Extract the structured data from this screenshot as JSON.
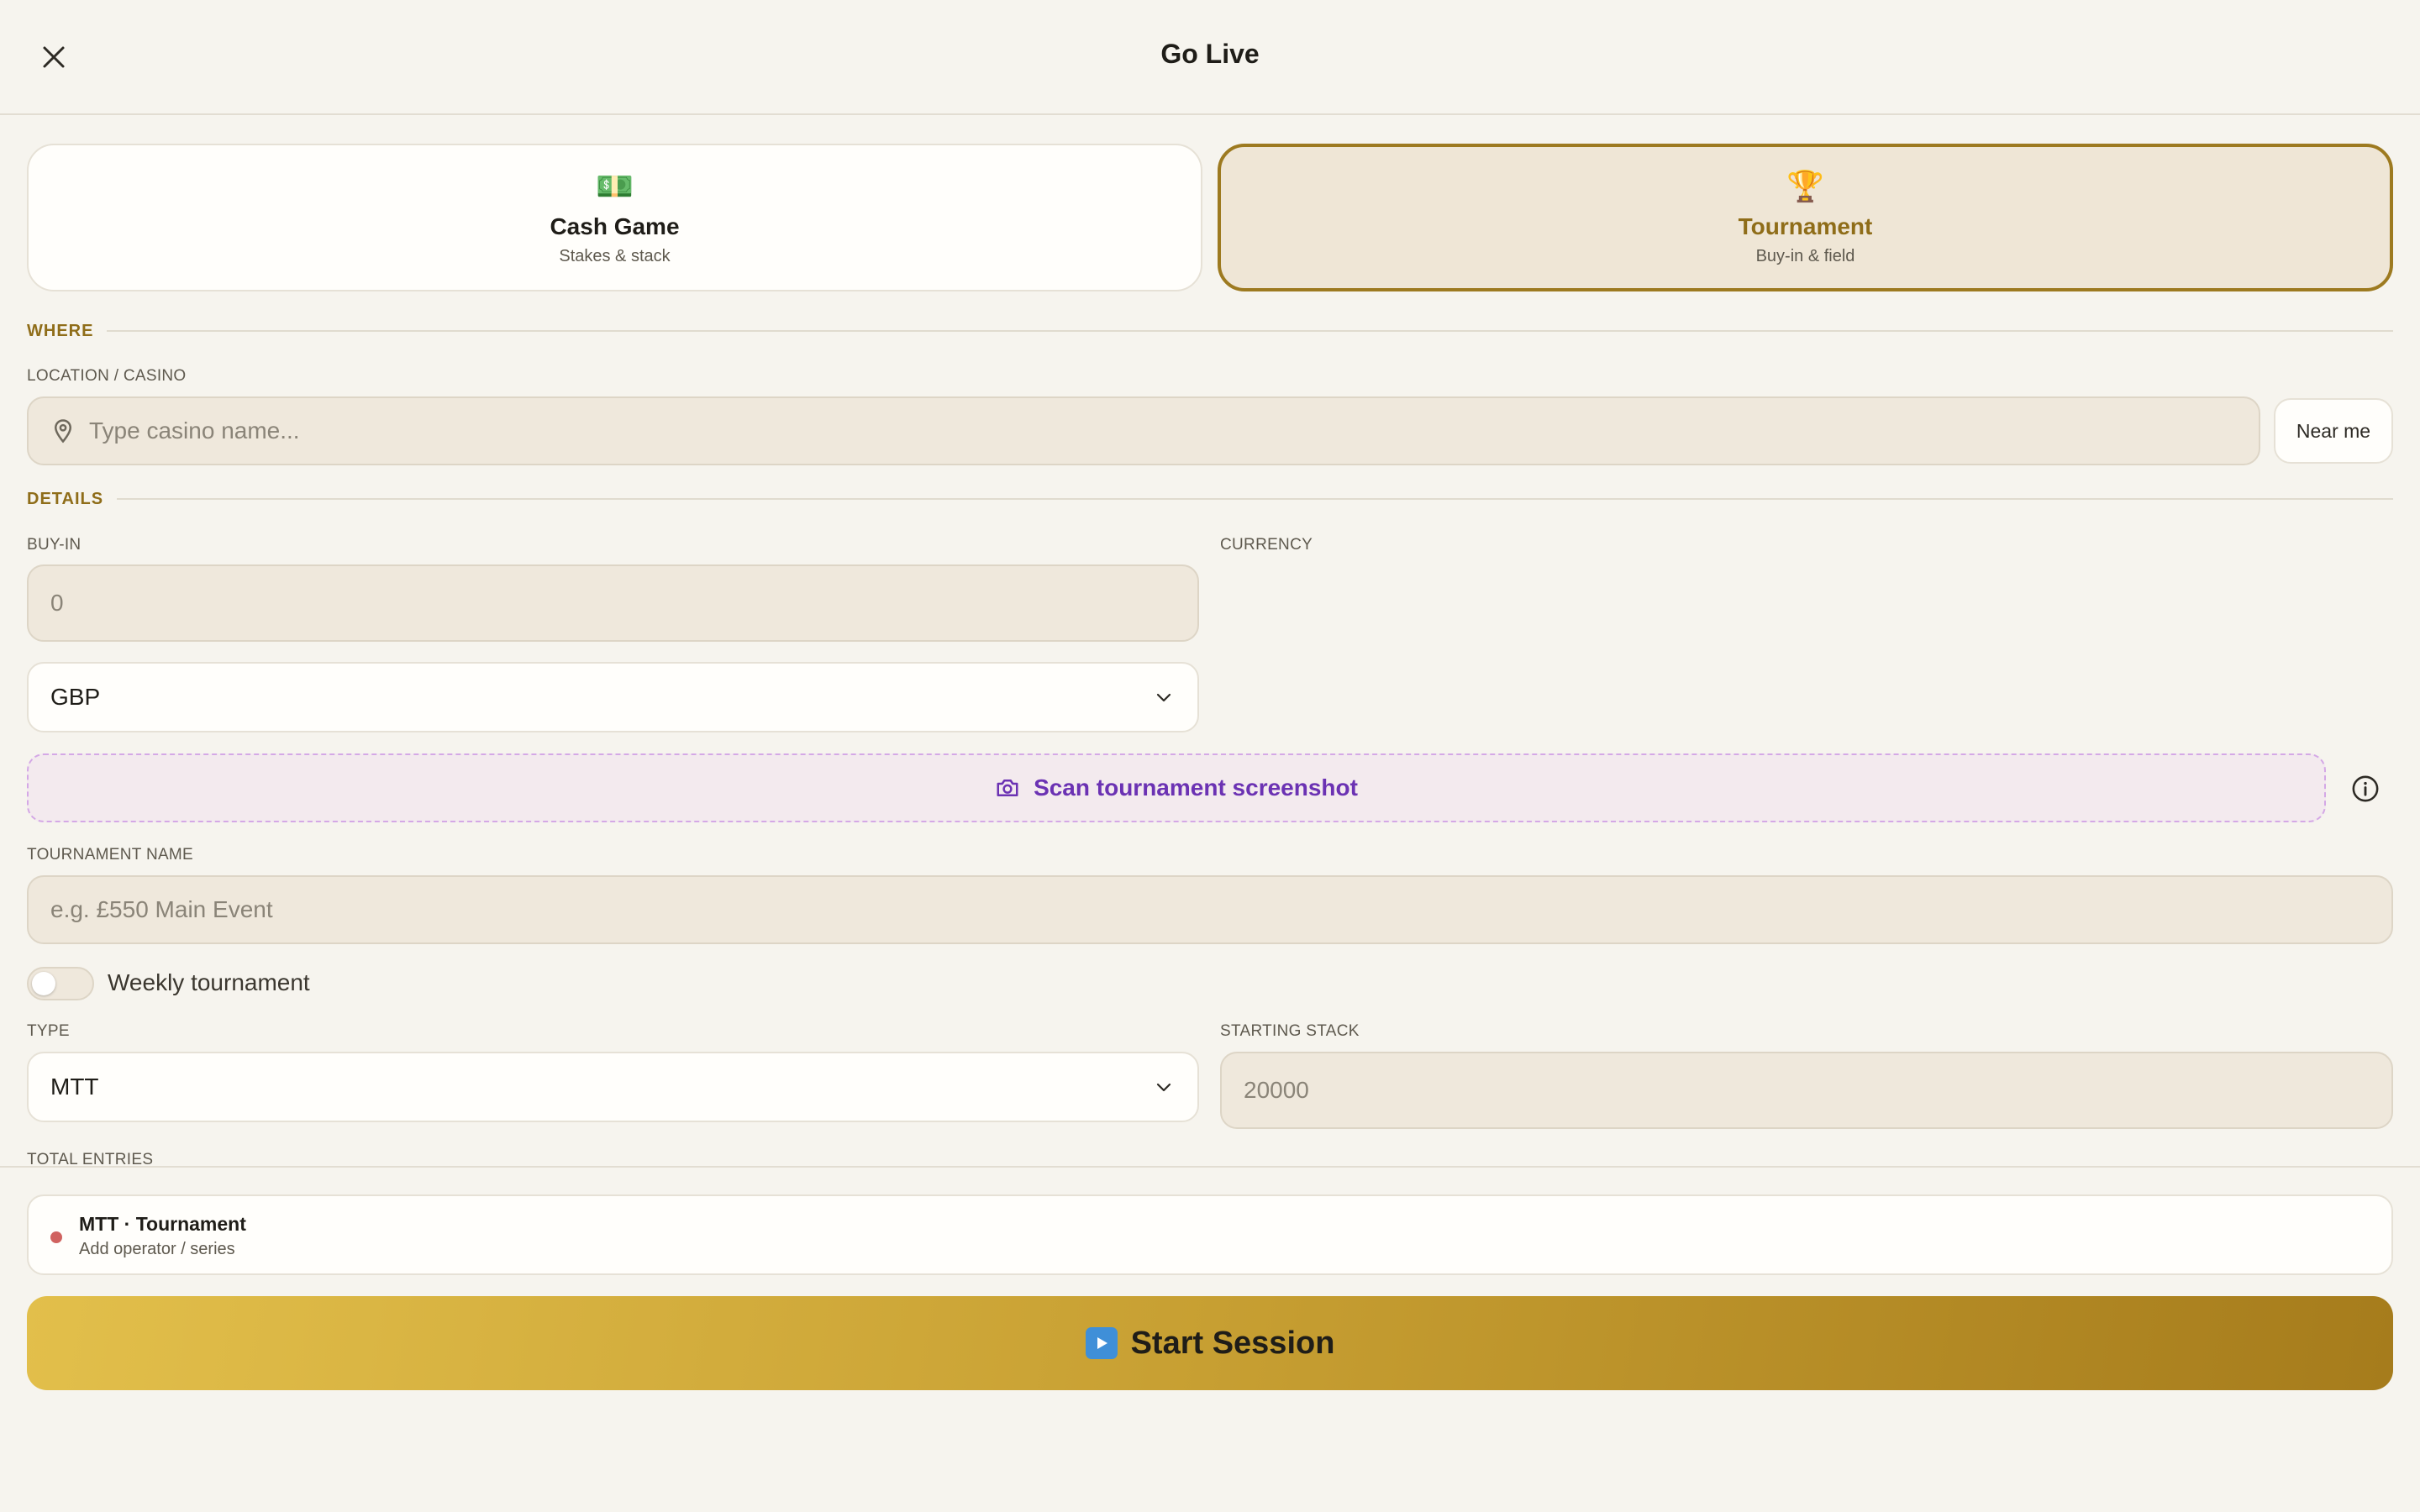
{
  "header": {
    "title": "Go Live",
    "close_icon": "close-icon"
  },
  "modes": {
    "cash": {
      "emoji": "💵",
      "label": "Cash Game",
      "sub": "Stakes & stack"
    },
    "tournament": {
      "emoji": "🏆",
      "label": "Tournament",
      "sub": "Buy-in & field",
      "selected": true
    }
  },
  "where": {
    "section": "WHERE",
    "location_label": "LOCATION / CASINO",
    "location_placeholder": "Type casino name...",
    "near_me": "Near me"
  },
  "details": {
    "section": "DETAILS",
    "buyin_label": "BUY-IN",
    "buyin_value": "0",
    "currency_label": "CURRENCY",
    "currency_value": "GBP",
    "scan_label": "Scan tournament screenshot",
    "tournament_name_label": "TOURNAMENT NAME",
    "tournament_name_placeholder": "e.g. £550 Main Event",
    "weekly_label": "Weekly tournament",
    "weekly_on": false,
    "type_label": "TYPE",
    "type_value": "MTT",
    "stack_label": "STARTING STACK",
    "stack_value": "20000",
    "total_entries_label": "TOTAL ENTRIES"
  },
  "summary": {
    "title": "MTT · Tournament",
    "sub": "Add operator / series",
    "dot_color": "#d0625f"
  },
  "start": {
    "label": "Start Session",
    "icon": "play-icon"
  },
  "colors": {
    "accent": "#8f6d19",
    "scan_accent": "#6b32b3",
    "background": "#f6f4ee"
  }
}
